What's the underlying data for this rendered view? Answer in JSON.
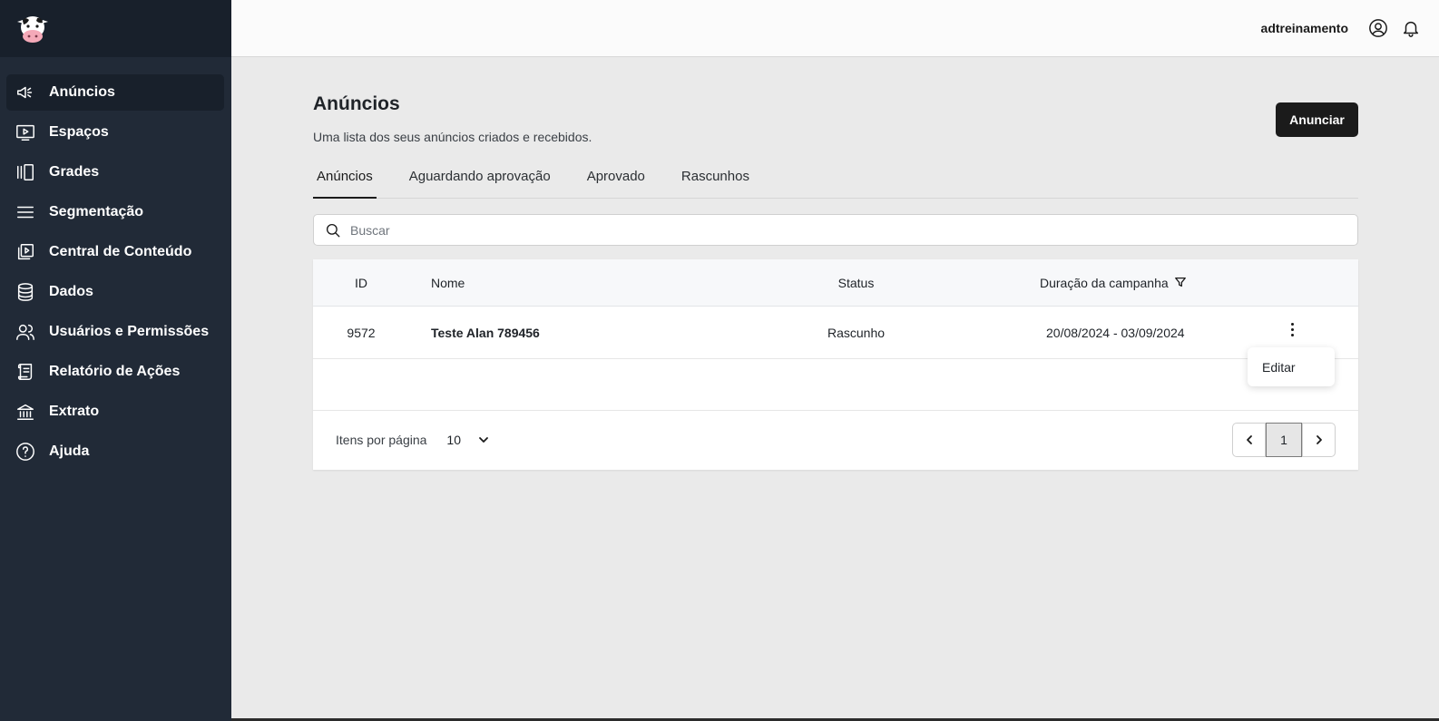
{
  "sidebar": {
    "logo_icon": "cow-logo-icon",
    "items": [
      {
        "label": "Anúncios",
        "icon": "megaphone-icon",
        "active": true
      },
      {
        "label": "Espaços",
        "icon": "monitor-play-icon",
        "active": false
      },
      {
        "label": "Grades",
        "icon": "panels-icon",
        "active": false
      },
      {
        "label": "Segmentação",
        "icon": "menu-lines-icon",
        "active": false
      },
      {
        "label": "Central de Conteúdo",
        "icon": "media-library-icon",
        "active": false
      },
      {
        "label": "Dados",
        "icon": "database-icon",
        "active": false
      },
      {
        "label": "Usuários e Permissões",
        "icon": "users-icon",
        "active": false
      },
      {
        "label": "Relatório de Ações",
        "icon": "scroll-icon",
        "active": false
      },
      {
        "label": "Extrato",
        "icon": "bank-icon",
        "active": false
      },
      {
        "label": "Ajuda",
        "icon": "help-circle-icon",
        "active": false
      }
    ]
  },
  "header": {
    "username": "adtreinamento",
    "user_icon": "user-circle-icon",
    "notification_icon": "bell-icon"
  },
  "page": {
    "title": "Anúncios",
    "subtitle": "Uma lista dos seus anúncios criados e recebidos.",
    "cta_label": "Anunciar"
  },
  "tabs": [
    {
      "label": "Anúncios",
      "active": true
    },
    {
      "label": "Aguardando aprovação",
      "active": false
    },
    {
      "label": "Aprovado",
      "active": false
    },
    {
      "label": "Rascunhos",
      "active": false
    }
  ],
  "search": {
    "placeholder": "Buscar"
  },
  "table": {
    "columns": {
      "id": "ID",
      "name": "Nome",
      "status": "Status",
      "duration": "Duração da campanha"
    },
    "rows": [
      {
        "id": "9572",
        "name": "Teste Alan 789456",
        "status": "Rascunho",
        "duration": "20/08/2024 - 03/09/2024"
      }
    ],
    "row_menu": {
      "edit_label": "Editar"
    }
  },
  "footer": {
    "per_page_label": "Itens por página",
    "per_page_value": "10",
    "current_page": "1"
  },
  "colors": {
    "sidebar_bg": "#212a37",
    "sidebar_active": "#18202b",
    "primary_button": "#1b1b1b",
    "page_bg": "#eaeaea"
  }
}
